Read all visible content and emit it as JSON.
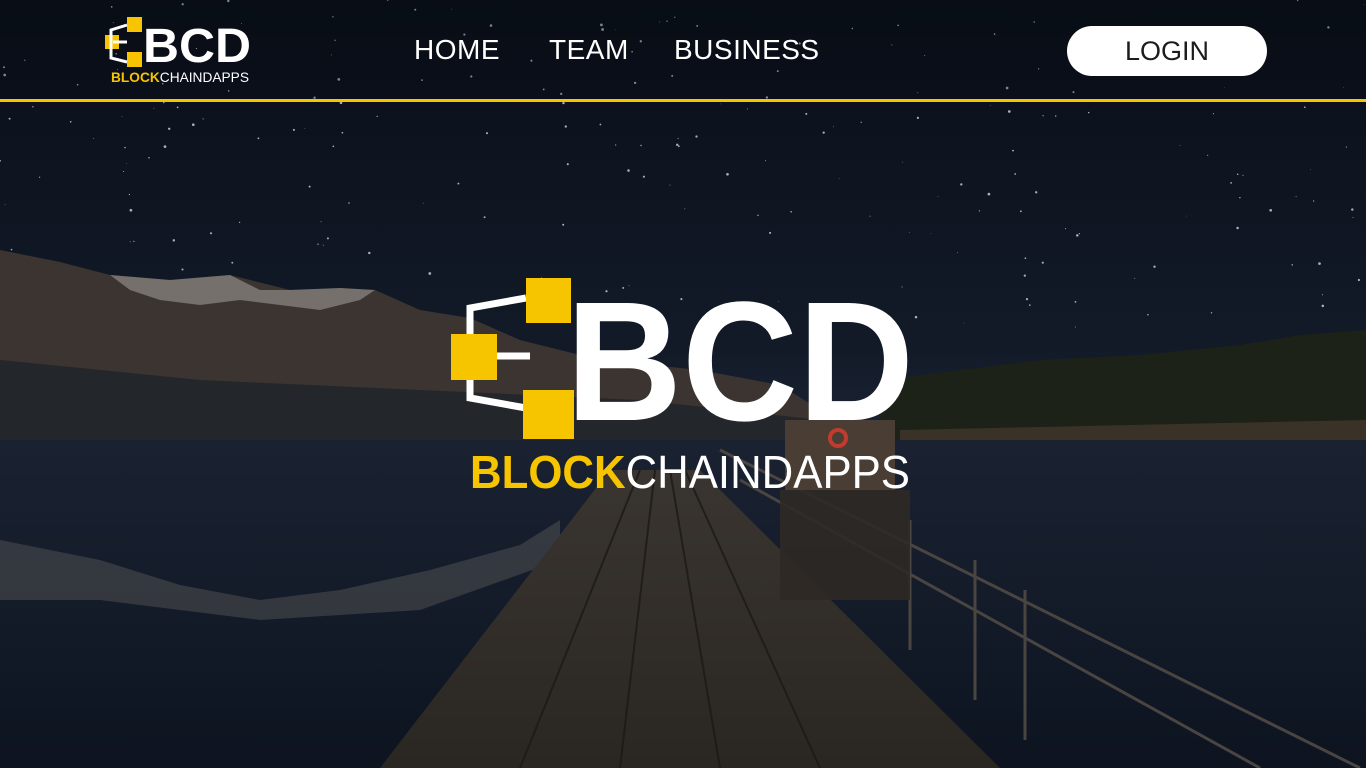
{
  "header": {
    "logo_small": {
      "main": "BCD",
      "sub_bold": "BLOCK",
      "sub_light": "CHAINDAPPS"
    },
    "nav": [
      {
        "label": "HOME"
      },
      {
        "label": "TEAM"
      },
      {
        "label": "BUSINESS"
      }
    ],
    "login_label": "LOGIN"
  },
  "hero": {
    "logo": {
      "main": "BCD",
      "sub_bold": "BLOCK",
      "sub_light": "CHAINDAPPS"
    }
  },
  "colors": {
    "accent": "#f7c400",
    "text": "#ffffff",
    "sky": "#0b111b"
  }
}
